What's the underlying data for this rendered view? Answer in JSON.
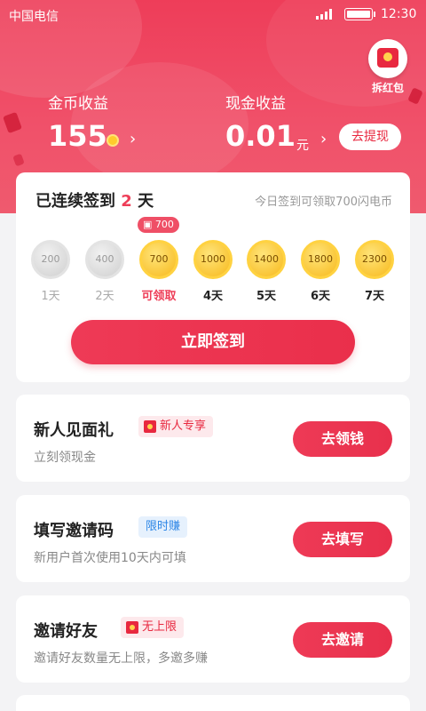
{
  "status_bar": {
    "carrier": "中国电信",
    "time": "12:30"
  },
  "header": {
    "red_packet_label": "拆红包",
    "coin_earnings": {
      "label": "金币收益",
      "value": "155"
    },
    "cash_earnings": {
      "label": "现金收益",
      "value": "0.01",
      "unit": "元",
      "withdraw_label": "去提现"
    }
  },
  "signin": {
    "title_prefix": "已连续签到",
    "streak_days": "2",
    "title_suffix": "天",
    "hint": "今日签到可领取700闪电币",
    "tooltip": "700",
    "days": [
      {
        "coins": "200",
        "label": "1天",
        "state": "done"
      },
      {
        "coins": "400",
        "label": "2天",
        "state": "done"
      },
      {
        "coins": "700",
        "label": "可领取",
        "state": "today"
      },
      {
        "coins": "1000",
        "label": "4天",
        "state": "future"
      },
      {
        "coins": "1400",
        "label": "5天",
        "state": "future"
      },
      {
        "coins": "1800",
        "label": "6天",
        "state": "future"
      },
      {
        "coins": "2300",
        "label": "7天",
        "state": "future"
      }
    ],
    "button_label": "立即签到"
  },
  "tasks": [
    {
      "title": "新人见面礼",
      "tag": "新人专享",
      "tag_style": "red",
      "desc": "立刻领现金",
      "button": "去领钱"
    },
    {
      "title": "填写邀请码",
      "tag": "限时赚",
      "tag_style": "blue",
      "desc": "新用户首次使用10天内可填",
      "button": "去填写"
    },
    {
      "title": "邀请好友",
      "tag": "无上限",
      "tag_style": "red",
      "desc": "邀请好友数量无上限，多邀多赚",
      "button": "去邀请"
    }
  ],
  "colors": {
    "accent": "#ee3e58",
    "gold": "#f7b81b",
    "tag_blue": "#2d86e6"
  }
}
